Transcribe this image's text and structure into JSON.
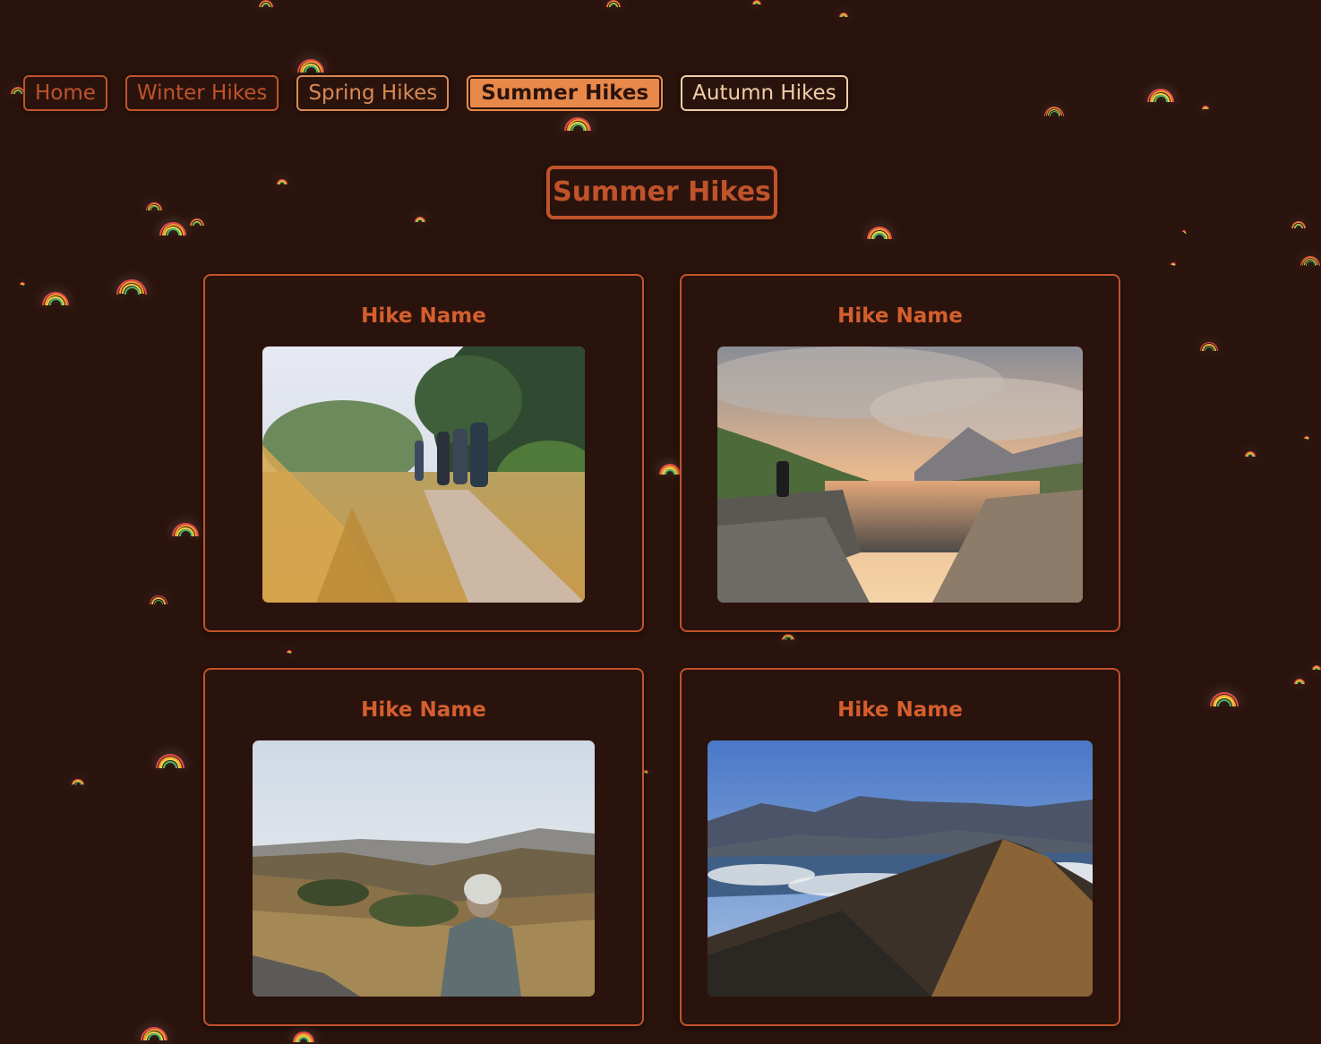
{
  "nav": {
    "items": [
      {
        "label": "Home"
      },
      {
        "label": "Winter Hikes"
      },
      {
        "label": "Spring Hikes"
      },
      {
        "label": "Summer Hikes"
      },
      {
        "label": "Autumn Hikes"
      }
    ],
    "active": "Summer Hikes"
  },
  "page": {
    "title": "Summer Hikes"
  },
  "hikes": [
    {
      "name": "Hike Name",
      "photo": "hikers-on-grassy-trail-photo"
    },
    {
      "name": "Hike Name",
      "photo": "mountain-lake-sunset-photo"
    },
    {
      "name": "Hike Name",
      "photo": "hiker-overlooking-hills-photo"
    },
    {
      "name": "Hike Name",
      "photo": "mountain-ridge-lake-photo"
    }
  ],
  "colors": {
    "background": "#2a130c",
    "accent": "#c0532b",
    "active_button": "#e8894a",
    "autumn_button": "#f0cfa8"
  },
  "icons": {
    "background_decor": "rainbow-icon"
  }
}
